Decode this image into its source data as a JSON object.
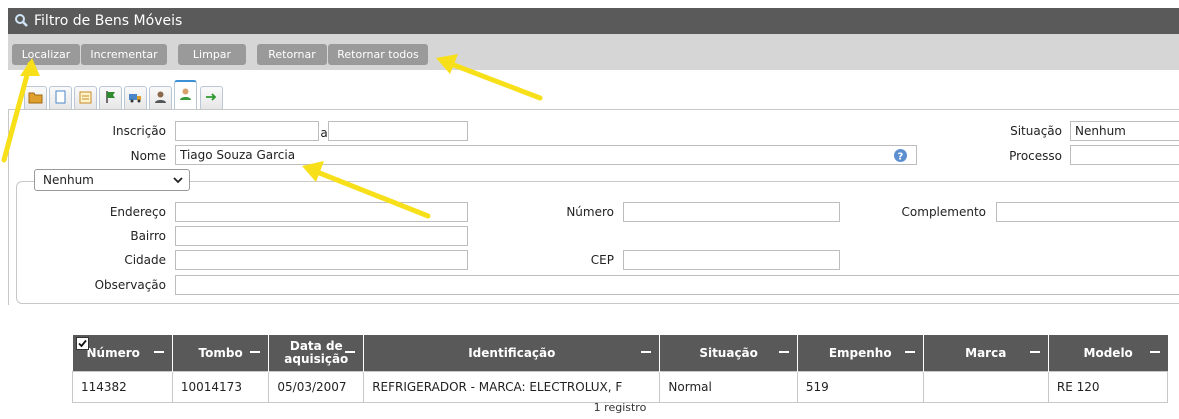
{
  "window": {
    "title": "Filtro de Bens Móveis"
  },
  "toolbar": {
    "buttons": [
      {
        "label": "Localizar"
      },
      {
        "label": "Incrementar"
      },
      {
        "label": "Limpar"
      },
      {
        "label": "Retornar"
      },
      {
        "label": "Retornar todos"
      }
    ]
  },
  "tabs": [
    {
      "icon": "folder-icon"
    },
    {
      "icon": "document-icon"
    },
    {
      "icon": "notepad-icon"
    },
    {
      "icon": "flag-icon"
    },
    {
      "icon": "truck-icon"
    },
    {
      "icon": "person-dark-icon"
    },
    {
      "icon": "person-green-icon",
      "active": true
    },
    {
      "icon": "arrow-right-icon"
    }
  ],
  "form": {
    "inscricao_label": "Inscrição",
    "inscricao_from": "",
    "range_sep": "a",
    "inscricao_to": "",
    "situacao_label": "Situação",
    "situacao_value": "Nenhum",
    "nome_label": "Nome",
    "nome_value": "Tiago Souza Garcia",
    "processo_label": "Processo",
    "processo_value": "",
    "address_type": "Nenhum",
    "endereco_label": "Endereço",
    "endereco_value": "",
    "numero_label": "Número",
    "numero_value": "",
    "complemento_label": "Complemento",
    "complemento_value": "",
    "bairro_label": "Bairro",
    "bairro_value": "",
    "cidade_label": "Cidade",
    "cidade_value": "",
    "cep_label": "CEP",
    "cep_value": "",
    "observacao_label": "Observação",
    "observacao_value": ""
  },
  "grid": {
    "columns": [
      "Número",
      "Tombo",
      "Data de aquisição",
      "Identificação",
      "Situação",
      "Empenho",
      "Marca",
      "Modelo"
    ],
    "rows": [
      [
        "114382",
        "10014173",
        "05/03/2007",
        "REFRIGERADOR - MARCA: ELECTROLUX, F",
        "Normal",
        "519",
        "",
        "RE 120"
      ]
    ],
    "footer": "1 registro"
  },
  "colors": {
    "titlebar": "#5a5a5a",
    "button": "#9a9a9a",
    "header": "#595959",
    "annotation": "#f7e01a"
  }
}
